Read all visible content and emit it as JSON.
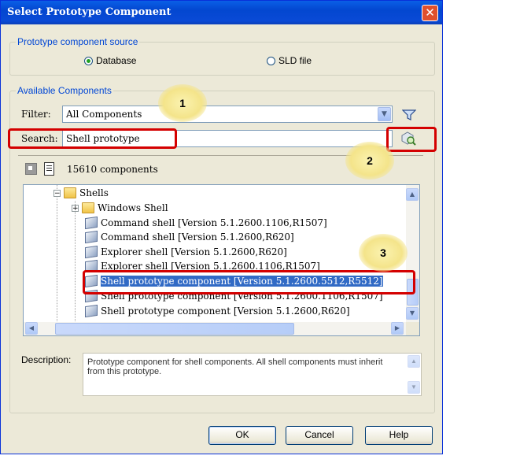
{
  "window": {
    "title": "Select Prototype Component",
    "close_glyph": "✕"
  },
  "source_group": {
    "legend": "Prototype component source",
    "options": [
      {
        "label": "Database",
        "selected": true
      },
      {
        "label": "SLD file",
        "selected": false
      }
    ]
  },
  "available_group": {
    "legend": "Available Components"
  },
  "filter": {
    "label": "Filter:",
    "value": "All Components",
    "icon": "funnel-icon"
  },
  "search": {
    "label": "Search:",
    "value": "Shell prototype",
    "button_icon": "search-go-icon"
  },
  "count": {
    "text": "15610 components"
  },
  "tree": {
    "items": [
      {
        "label": "Shells",
        "type": "folder",
        "expander": "−"
      },
      {
        "label": "Windows Shell",
        "type": "folder",
        "expander": "+"
      },
      {
        "label": "Command shell [Version 5.1.2600.1106,R1507]",
        "type": "component"
      },
      {
        "label": "Command shell [Version 5.1.2600,R620]",
        "type": "component"
      },
      {
        "label": "Explorer shell [Version 5.1.2600,R620]",
        "type": "component"
      },
      {
        "label": "Explorer shell [Version 5.1.2600.1106,R1507]",
        "type": "component"
      },
      {
        "label": "Shell prototype component [Version 5.1.2600.5512,R5512]",
        "type": "component",
        "selected": true
      },
      {
        "label": "Shell prototype component [Version 5.1.2600.1106,R1507]",
        "type": "component"
      },
      {
        "label": "Shell prototype component [Version 5.1.2600,R620]",
        "type": "component"
      }
    ]
  },
  "description": {
    "label": "Description:",
    "text": "Prototype component for shell components. All shell components must inherit from this prototype."
  },
  "buttons": {
    "ok": "OK",
    "cancel": "Cancel",
    "help": "Help"
  },
  "callouts": [
    "1",
    "2",
    "3"
  ],
  "colors": {
    "highlight": "#d40000",
    "selection": "#316ac5",
    "titlebar": "#0347d0"
  }
}
